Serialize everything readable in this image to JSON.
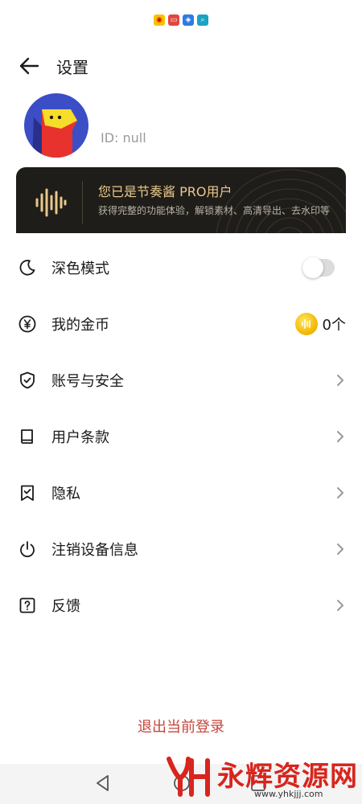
{
  "header": {
    "title": "设置"
  },
  "profile": {
    "id_text": "ID: null"
  },
  "pro_card": {
    "title": "您已是节奏酱 PRO用户",
    "subtitle": "获得完整的功能体验，解锁素材、高清导出、去水印等"
  },
  "menu": {
    "dark_mode": {
      "label": "深色模式",
      "enabled": false
    },
    "coins": {
      "label": "我的金币",
      "count": "0个"
    },
    "account": {
      "label": "账号与安全"
    },
    "terms": {
      "label": "用户条款"
    },
    "privacy": {
      "label": "隐私"
    },
    "deregister": {
      "label": "注销设备信息"
    },
    "feedback": {
      "label": "反馈"
    }
  },
  "logout_label": "退出当前登录",
  "watermark": {
    "name": "永辉资源网",
    "url": "www.yhkjjj.com"
  },
  "colors": {
    "accent_red": "#c4453c",
    "pro_gold": "#e8c88a",
    "coin_gold": "#f1b400",
    "watermark_red": "#d8251d"
  },
  "icons": {
    "status": [
      "weibo-icon",
      "app-red-icon",
      "bulb-icon",
      "search-app-icon"
    ],
    "menu": [
      "moon-icon",
      "yen-coin-icon",
      "shield-check-icon",
      "book-icon",
      "bookmark-check-icon",
      "power-icon",
      "question-icon"
    ]
  }
}
